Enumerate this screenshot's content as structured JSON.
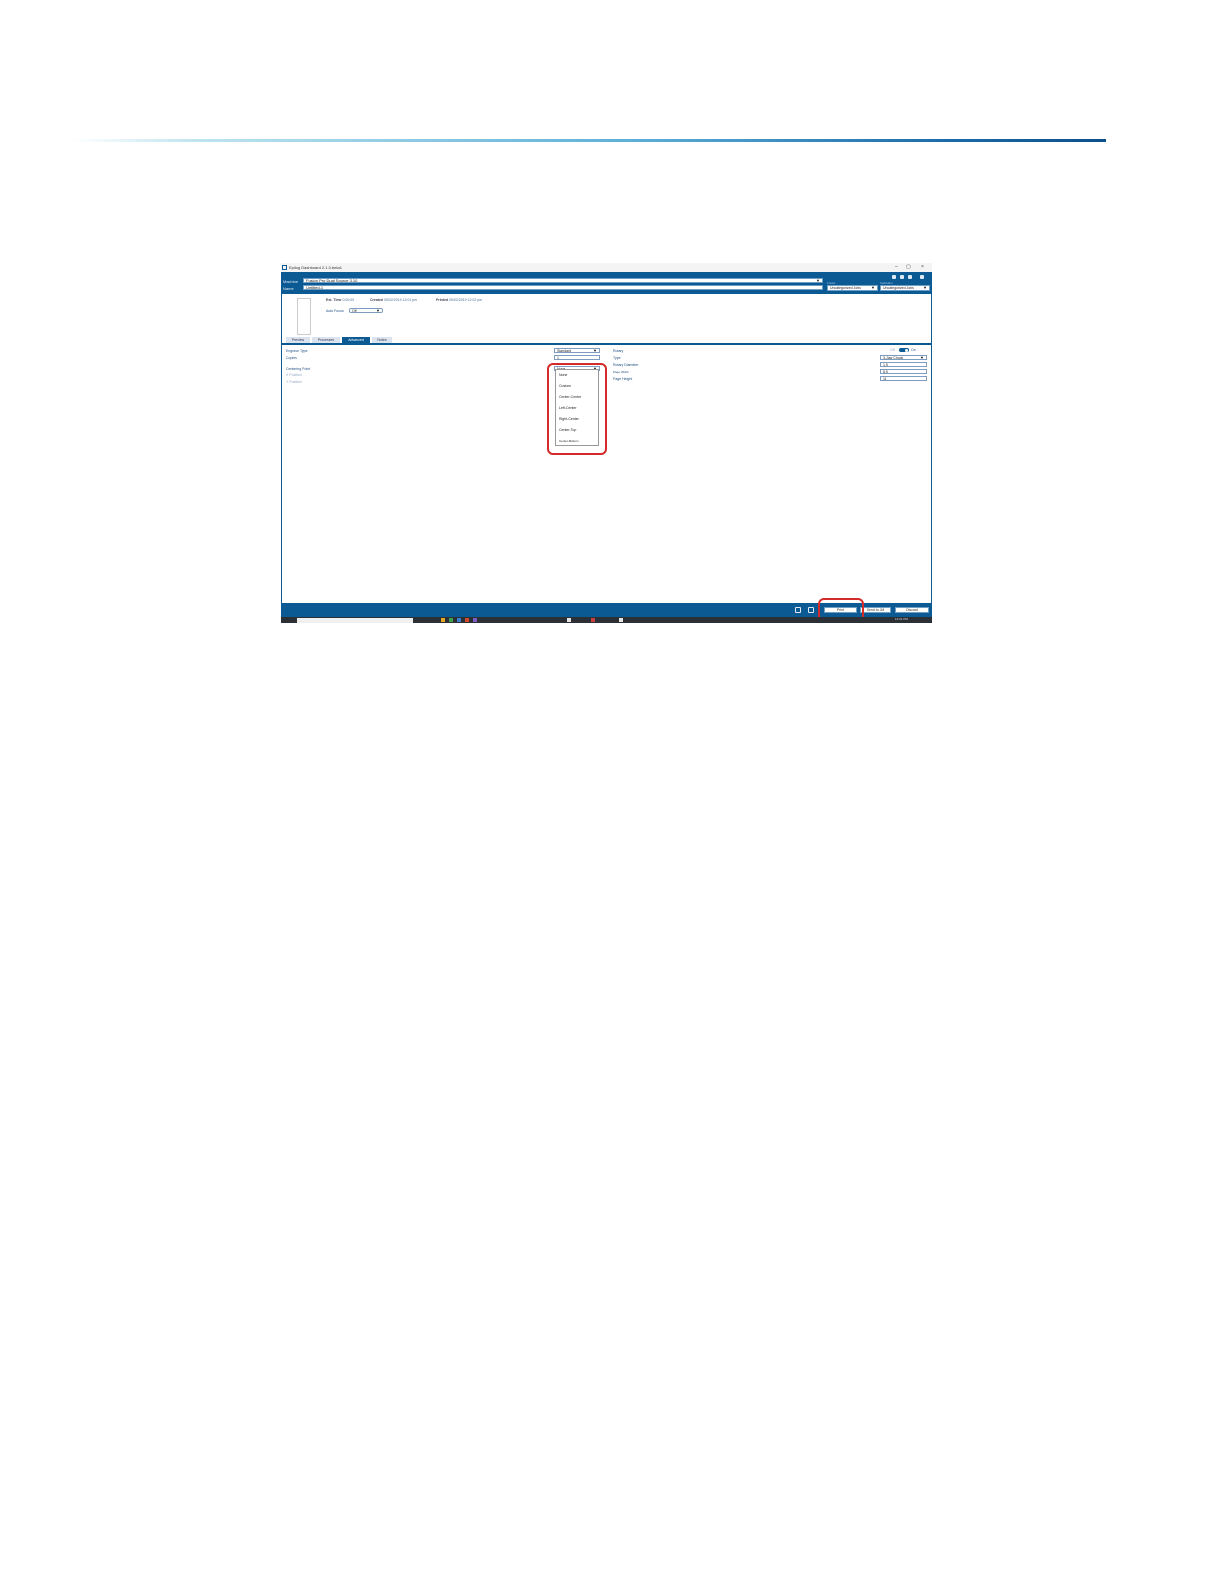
{
  "window": {
    "title": "Epilog Dashboard 2.1.0.beta1",
    "minimize": "–",
    "maximize": "▢",
    "close": "×"
  },
  "header": {
    "machine_label": "Machine",
    "machine_value": "Fusion Pro Dual Source 3.10",
    "name_label": "Name",
    "name_value": "Untitled-1",
    "folder_label": "Folder",
    "folder_value": "Uncategorized Jobs",
    "subfolder_label": "Subfolder",
    "subfolder_value": "Uncategorized Jobs"
  },
  "job_info": {
    "run_time_label": "Est. Time",
    "run_time_value": "0:00:00",
    "created_label": "Created",
    "created_value": "05/02/2019 12:01 pm",
    "printed_label": "Printed",
    "printed_value": "05/02/2019 12:02 pm",
    "auto_focus_label": "Auto Focus",
    "auto_focus_value": "Off"
  },
  "tabs": [
    "Preview",
    "Processes",
    "Advanced",
    "Notes"
  ],
  "advanced": {
    "engrave_type_label": "Engrave Type",
    "engrave_type_value": "Standard",
    "copies_label": "Copies",
    "copies_value": "1",
    "centering_point_label": "Centering Point",
    "centering_point_value": "None",
    "x_position_label": "X Position",
    "y_position_label": "Y Position",
    "rotary_label": "Rotary",
    "rotary_off": "Off",
    "rotary_on": "On",
    "type_label": "Type",
    "type_value": "3-Jaw Chuck",
    "rotary_diameter_label": "Rotary Diameter",
    "rotary_diameter_value": "1.5",
    "page_width_label": "Page Width",
    "page_width_value": "8.5",
    "page_height_label": "Page Height",
    "page_height_value": "11"
  },
  "centering_options": [
    "None",
    "Custom",
    "Center-Center",
    "Left-Center",
    "Right-Center",
    "Center-Top",
    "Center-Bottom"
  ],
  "footer": {
    "print_label": "Print",
    "send_label": "Send to JM",
    "discard_label": "Discard"
  },
  "taskbar": {
    "clock": "12:01 PM"
  },
  "colors": {
    "brand": "#0b5a94",
    "highlight": "#d42a2a"
  },
  "icons": [
    "app-icon",
    "settings-icon",
    "help-icon",
    "stats-icon",
    "camera-icon",
    "save-icon"
  ]
}
